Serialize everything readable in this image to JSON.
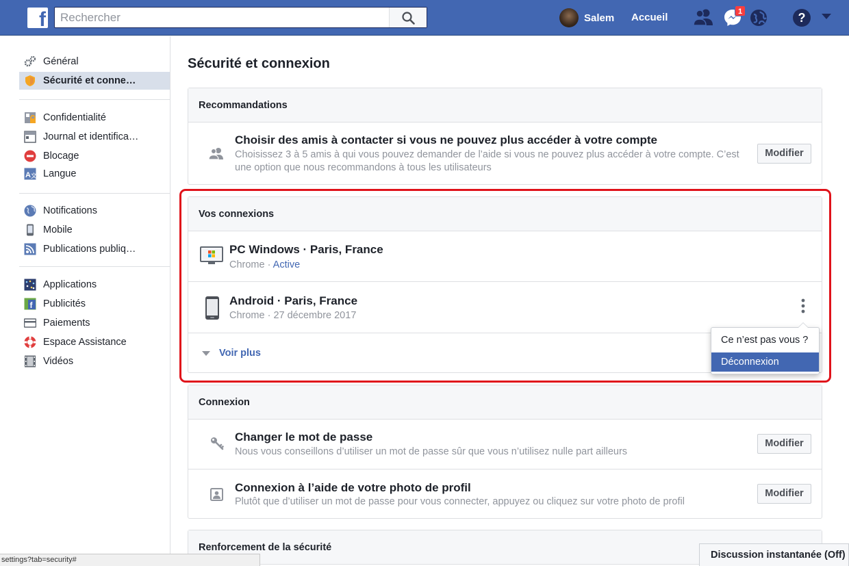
{
  "header": {
    "logo": "f",
    "search_placeholder": "Rechercher",
    "user_name": "Salem",
    "home_label": "Accueil",
    "messages_badge": "1"
  },
  "sidebar": {
    "group1": [
      {
        "label": "Général",
        "icon": "gears-icon"
      },
      {
        "label": "Sécurité et conne…",
        "icon": "shield-icon",
        "active": true
      }
    ],
    "group2": [
      {
        "label": "Confidentialité",
        "icon": "lock-icon"
      },
      {
        "label": "Journal et identifica…",
        "icon": "timeline-icon"
      },
      {
        "label": "Blocage",
        "icon": "block-icon"
      },
      {
        "label": "Langue",
        "icon": "language-icon"
      }
    ],
    "group3": [
      {
        "label": "Notifications",
        "icon": "globe-icon"
      },
      {
        "label": "Mobile",
        "icon": "phone-icon"
      },
      {
        "label": "Publications publiq…",
        "icon": "rss-icon"
      }
    ],
    "group4": [
      {
        "label": "Applications",
        "icon": "apps-icon"
      },
      {
        "label": "Publicités",
        "icon": "ads-icon"
      },
      {
        "label": "Paiements",
        "icon": "card-icon"
      },
      {
        "label": "Espace Assistance",
        "icon": "lifebuoy-icon"
      },
      {
        "label": "Vidéos",
        "icon": "film-icon"
      }
    ]
  },
  "main": {
    "title": "Sécurité et connexion",
    "recommendations": {
      "heading": "Recommandations",
      "title": "Choisir des amis à contacter si vous ne pouvez plus accéder à votre compte",
      "desc_line1": "Choisissez 3 à 5 amis à qui vous pouvez demander de l’aide si vous ne pouvez plus accéder à votre compte. C’est",
      "desc_line2": "une option que nous recommandons à tous les utilisateurs",
      "button": "Modifier"
    },
    "connections": {
      "heading": "Vos connexions",
      "sessions": [
        {
          "device": "PC Windows · Paris, France",
          "browser": "Chrome · ",
          "status": "Active"
        },
        {
          "device": "Android · Paris, France",
          "browser": "Chrome · 27 décembre 2017"
        }
      ],
      "see_more": "Voir plus",
      "menu": {
        "not_you": "Ce n’est pas vous ?",
        "logout": "Déconnexion"
      }
    },
    "login": {
      "heading": "Connexion",
      "rows": [
        {
          "title": "Changer le mot de passe",
          "desc": "Nous vous conseillons d’utiliser un mot de passe sûr que vous n’utilisez nulle part ailleurs",
          "button": "Modifier"
        },
        {
          "title": "Connexion à l’aide de votre photo de profil",
          "desc": "Plutôt que d’utiliser un mot de passe pour vous connecter, appuyez ou cliquez sur votre photo de profil",
          "button": "Modifier"
        }
      ]
    },
    "hardening": {
      "heading": "Renforcement de la sécurité"
    }
  },
  "status_url": "settings?tab=security#",
  "chat": {
    "label": "Discussion instantanée (Off)"
  },
  "colors": {
    "brand": "#4267b2",
    "link": "#4267b2",
    "highlight": "#e0121a",
    "active_item": "#d8dfea"
  }
}
